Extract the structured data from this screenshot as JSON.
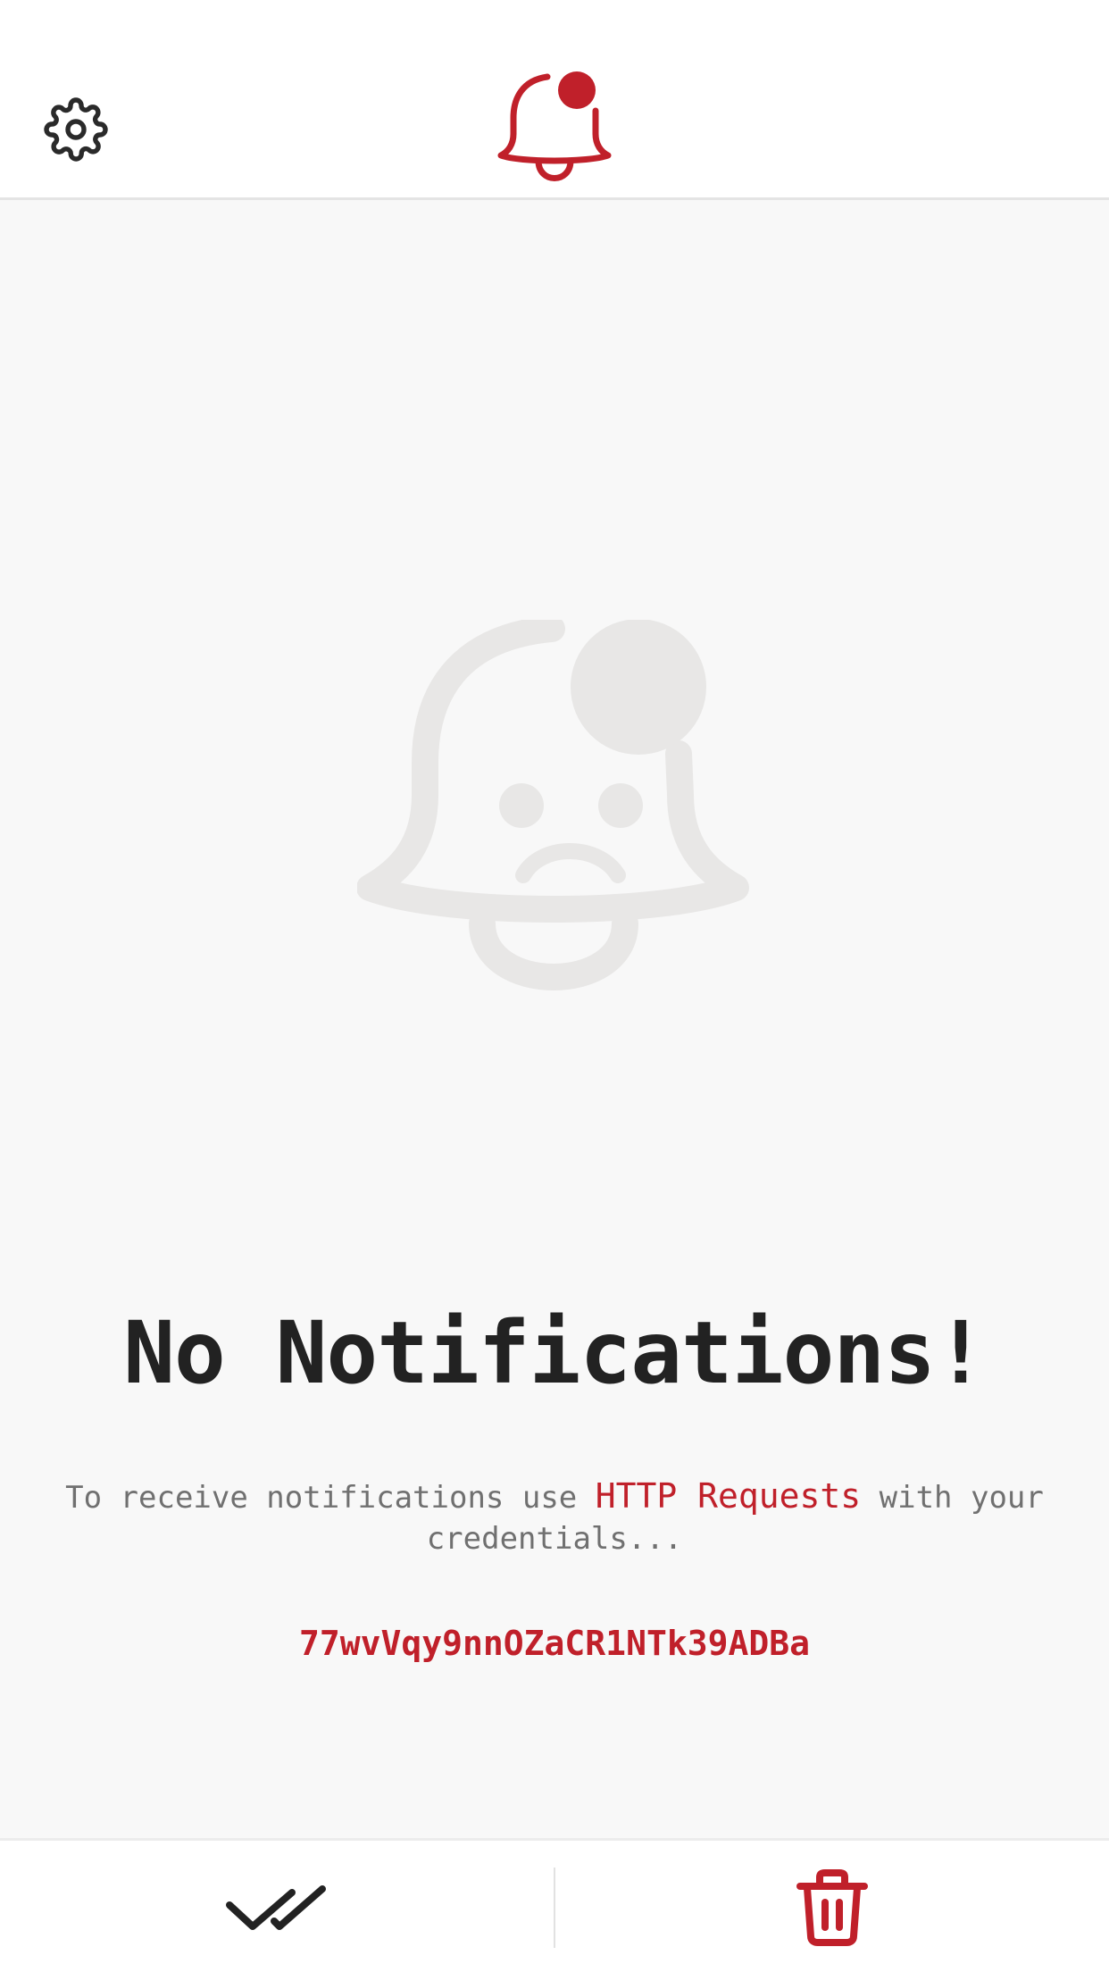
{
  "header": {
    "settings_icon": "gear-icon",
    "logo_icon": "bell-icon"
  },
  "empty_state": {
    "illustration_icon": "sad-bell-icon",
    "title": "No Notifications!",
    "description_prefix": "To receive notifications use ",
    "description_link": "HTTP Requests",
    "description_suffix": " with your credentials...",
    "credential": "77wvVqy9nnOZaCR1NTk39ADBa"
  },
  "bottom_bar": {
    "mark_all_read_icon": "double-check-icon",
    "delete_all_icon": "trash-icon"
  },
  "colors": {
    "accent": "#c0202a",
    "text_dark": "#222222",
    "text_muted": "#707070",
    "illustration": "#e8e7e6",
    "background": "#f8f8f8"
  }
}
